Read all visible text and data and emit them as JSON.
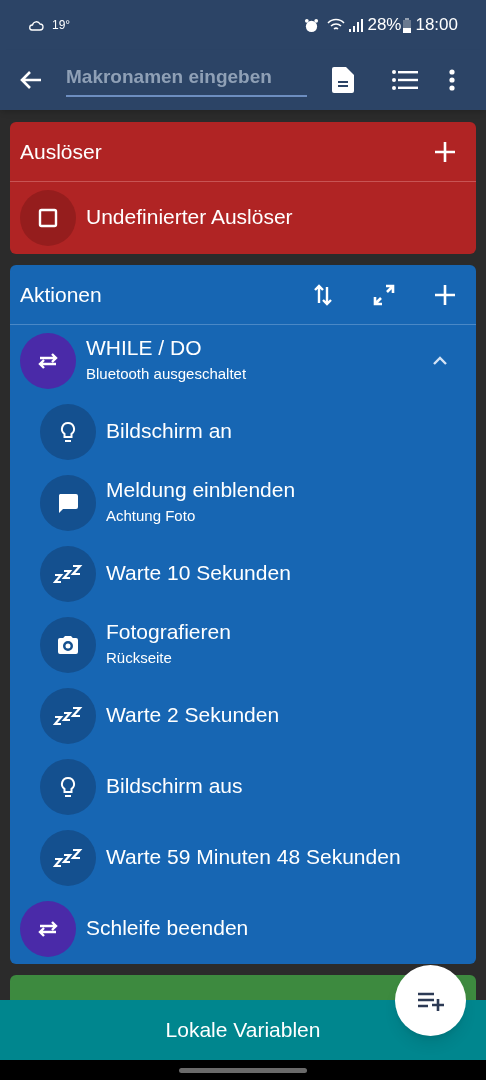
{
  "status_bar": {
    "weather": "19°",
    "battery": "28%",
    "time": "18:00"
  },
  "toolbar": {
    "placeholder": "Makronamen eingeben"
  },
  "trigger_section": {
    "title": "Auslöser",
    "items": [
      {
        "kind": "unset",
        "label": "Undefinierter Auslöser"
      }
    ]
  },
  "actions_section": {
    "title": "Aktionen",
    "items": [
      {
        "kind": "loop",
        "label": "WHILE / DO",
        "detail": "Bluetooth ausgeschaltet",
        "expanded": true,
        "children": [
          {
            "kind": "display",
            "label": "Bildschirm an"
          },
          {
            "kind": "notify",
            "label": "Meldung einblenden",
            "detail": "Achtung Foto"
          },
          {
            "kind": "wait",
            "label": "Warte 10 Sekunden"
          },
          {
            "kind": "camera",
            "label": "Fotografieren",
            "detail": "Rückseite"
          },
          {
            "kind": "wait",
            "label": "Warte 2 Sekunden"
          },
          {
            "kind": "display",
            "label": "Bildschirm aus"
          },
          {
            "kind": "wait",
            "label": "Warte 59 Minuten 48 Sekunden"
          }
        ]
      },
      {
        "kind": "loop",
        "label": "Schleife beenden"
      }
    ]
  },
  "bottom_bar": {
    "label": "Lokale Variablen"
  }
}
